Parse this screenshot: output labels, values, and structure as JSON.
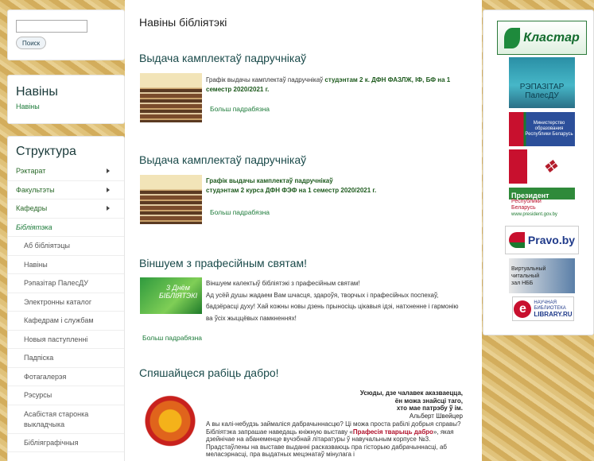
{
  "search": {
    "button": "Поиск",
    "placeholder": ""
  },
  "news_block": {
    "title": "Навіны",
    "link": "Навіны"
  },
  "structure": {
    "title": "Структура",
    "items": [
      {
        "label": "Рэктарат",
        "arrow": true
      },
      {
        "label": "Факультэты",
        "arrow": true
      },
      {
        "label": "Кафедры",
        "arrow": true
      },
      {
        "label": "Бібліятэка",
        "arrow": false
      }
    ],
    "subitems": [
      "Аб бібліятэцы",
      "Навіны",
      "Рэпазітар ПалесДУ",
      "Электронны каталог",
      "Кафедрам і службам",
      "Новыя паступленні",
      "Падпіска",
      "Фотагалерэя",
      "Рэсурсы",
      "Асабістая старонка выкладчыка",
      "Бібліяграфічныя"
    ]
  },
  "page_title": "Навіны бібліятэкі",
  "articles": [
    {
      "title": "Выдача камплектаў падручнікаў",
      "text_plain": "Графік выдачы камплектаў падручнікаў ",
      "text_bold": "студэнтам 2 к. ДФН ФАЗЛЖ, ІФ, БФ на 1 семестр 2020/2021 г.",
      "more": "Больш падрабязна"
    },
    {
      "title": "Выдача камплектаў падручнікаў",
      "text_bold1": "Графік выдачы камплектаў падручнікаў",
      "text_bold2": "студэнтам 2 курса ДФН ФЭФ на 1 семестр 2020/2021 г.",
      "more": "Больш падрабязна"
    },
    {
      "title": "Віншуем з прафесійным святам!",
      "thumb_text": "3 Днём БІБЛІЯТЭКІ",
      "p1": "Віншуем калектыў бібліятэкі з прафесійным святам!",
      "p2": "Ад усёй душы жадаем Вам шчасця, здароўя, творчых і прафесійных поспехаў, бадзёрасці духу! Хай кожны новы дзень прыносіць цікавыя ідэі, натхненне і гармонію ва ўсіх жыццёвых памкненнях!",
      "more": "Больш падрабязна"
    },
    {
      "title": "Спяшайцеся рабіць дабро!",
      "quote1": "Усюды, дзе чалавек аказваецца,",
      "quote2": "ён можа знайсці таго,",
      "quote3": "хто мае патрэбу ў ім.",
      "author": "Альберт Швейцер",
      "body1": "А вы калі-небудзь займаліся дабрачыннасцю? Ці можа проста рабілі добрыя справы? Бібліятэка запрашае наведаць кніжную выставу «",
      "body_bold": "Прафесія тварыць дабро",
      "body2": "», якая дзейнічае на абанеменце вучэбнай літаратуры ў навучальным корпусе №3. Прадстаўлены на выставе выданні расказваюць пра гісторыю дабрачыннасці, аб меласэрнасці, пра выдатных мецэнатаў мінулага і"
    }
  ],
  "banners": {
    "klastar": "Кластар",
    "repo1": "РЭПАЗІТАР",
    "repo2": "ПалесДУ",
    "ministry1": "Министерство",
    "ministry2": "образования",
    "ministry3": "Республики Беларусь",
    "pres1": "Президент",
    "pres2": "Республики",
    "pres3": "Беларусь",
    "pres4": "www.president.gov.by",
    "pravo": "Pravo.by",
    "virt1": "Виртуальный",
    "virt2": "читальный",
    "virt3": "зал НББ",
    "elib1": "НАУЧНАЯ",
    "elib2": "БИБЛИОТЕКА",
    "elib3": "LIBRARY.RU"
  },
  "colors": {
    "link": "#1d7b3a",
    "heading": "#1a4a4a"
  }
}
